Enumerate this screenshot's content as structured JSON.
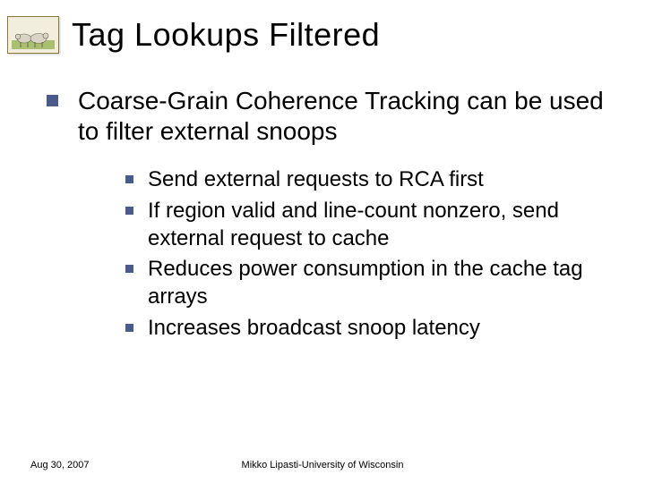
{
  "slide": {
    "title": "Tag Lookups Filtered",
    "main_point": "Coarse-Grain Coherence Tracking can be used to filter external snoops",
    "sub_points": [
      "Send external requests to RCA first",
      "If region valid and line-count nonzero, send external request to cache",
      "Reduces power consumption in the cache tag arrays",
      "Increases broadcast snoop latency"
    ],
    "footer": {
      "date": "Aug 30, 2007",
      "affiliation": "Mikko Lipasti-University of Wisconsin"
    }
  }
}
